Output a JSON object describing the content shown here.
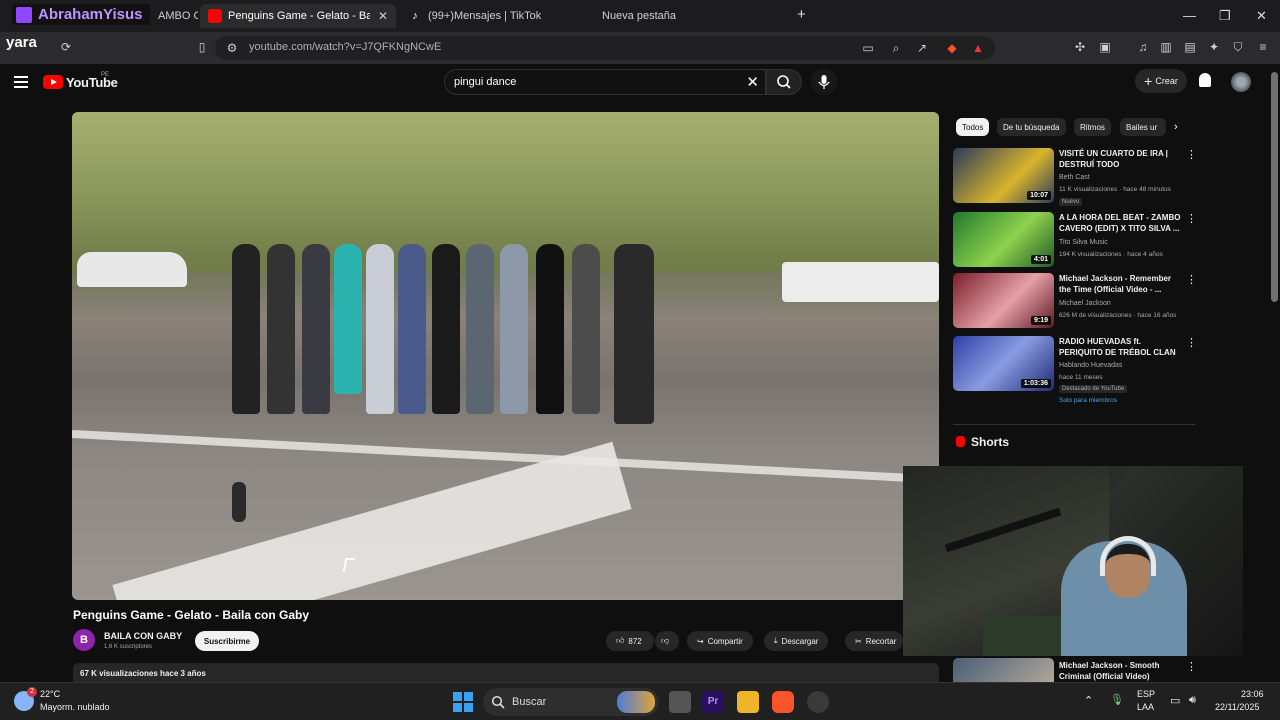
{
  "browser": {
    "overlay_name": "AbrahamYisus",
    "tabs": [
      {
        "label": "AMBO C"
      },
      {
        "label": "Penguins Game - Gelato - Baila c"
      },
      {
        "label": "(99+)Mensajes | TikTok"
      },
      {
        "label": "Nueva pestaña"
      }
    ],
    "overlay_user": "yara",
    "url": "youtube.com/watch?v=J7QFKNgNCwE"
  },
  "youtube": {
    "logo_text": "YouTube",
    "region": "PE",
    "search_query": "pingui dance",
    "create_label": "Crear"
  },
  "video": {
    "title": "Penguins Game - Gelato - Baila con Gaby",
    "channel": "BAILA CON GABY",
    "channel_initial": "B",
    "subscribers": "1,6 K suscriptores",
    "subscribe_label": "Suscribirme",
    "likes": "872",
    "share_label": "Compartir",
    "download_label": "Descargar",
    "clip_label": "Recortar",
    "views_meta": "67 K visualizaciones  hace 3 años"
  },
  "chips": [
    {
      "label": "Todos",
      "selected": true
    },
    {
      "label": "De tu búsqueda",
      "selected": false
    },
    {
      "label": "Ritmos",
      "selected": false
    },
    {
      "label": "Bailes ur",
      "selected": false
    }
  ],
  "recommendations": [
    {
      "title": "VISITÉ UN CUARTO DE IRA | DESTRUÍ TODO",
      "channel": "Beth Cast",
      "meta": "11 K visualizaciones · hace 48 minutos",
      "badge": "Nuevo",
      "duration": "10:07",
      "thumb_color": "#2a3a5c"
    },
    {
      "title": "A LA HORA DEL BEAT - ZAMBO CAVERO (EDIT) X TITO SILVA ...",
      "channel": "Tito Silva Music",
      "meta": "194 K visualizaciones · hace 4 años",
      "badge": "",
      "duration": "4:01",
      "thumb_color": "#1f7a2e"
    },
    {
      "title": "Michael Jackson - Remember the Time (Official Video - ...",
      "channel": "Michael Jackson",
      "meta": "626 M de visualizaciones · hace 16 años",
      "badge": "",
      "duration": "9:19",
      "thumb_color": "#7a1e2a"
    },
    {
      "title": "RADIO HUEVADAS ft. PERIQUITO DE TRÉBOL CLAN",
      "channel": "Hablando Huevadas",
      "meta": "hace 11 meses",
      "badge": "Destacado de YouTube",
      "badge2": "Solo para miembros",
      "duration": "1:03:36",
      "thumb_color": "#2e3fa8"
    },
    {
      "title": "Michael Jackson - Smooth Criminal (Official Video)",
      "channel": "",
      "meta": "",
      "badge": "",
      "duration": "",
      "thumb_color": "#4a5e78"
    }
  ],
  "shorts_label": "Shorts",
  "taskbar": {
    "temp": "22°C",
    "weather": "Mayorm. nublado",
    "weather_badge": "2",
    "search_label": "Buscar",
    "lang1": "ESP",
    "lang2": "LAA",
    "time": "23:06",
    "date": "22/11/2025"
  }
}
